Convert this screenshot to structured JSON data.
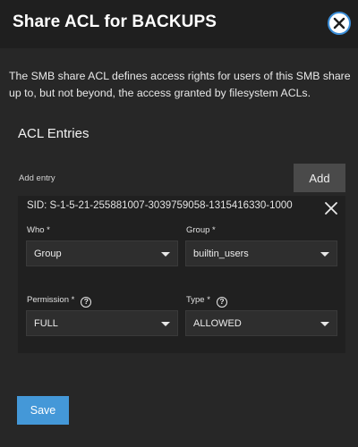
{
  "dialog": {
    "title": "Share ACL for BACKUPS",
    "close_icon": "close-circle-icon",
    "description": "The SMB share ACL defines access rights for users of this SMB share up to, but not beyond, the access granted by filesystem ACLs."
  },
  "acl": {
    "section_title": "ACL Entries",
    "add_entry_label": "Add entry",
    "add_label": "Add",
    "entry": {
      "sid": "SID: S-1-5-21-255881007-3039759058-1315416330-1000",
      "remove_icon": "close-icon",
      "who": {
        "label": "Who *",
        "value": "Group"
      },
      "group": {
        "label": "Group *",
        "value": "builtin_users"
      },
      "permission": {
        "label": "Permission *",
        "value": "FULL",
        "help": "?"
      },
      "type": {
        "label": "Type *",
        "value": "ALLOWED",
        "help": "?"
      }
    }
  },
  "actions": {
    "save_label": "Save"
  },
  "colors": {
    "accent": "#4498d8",
    "background": "#272727",
    "header": "#1f1f1f"
  }
}
